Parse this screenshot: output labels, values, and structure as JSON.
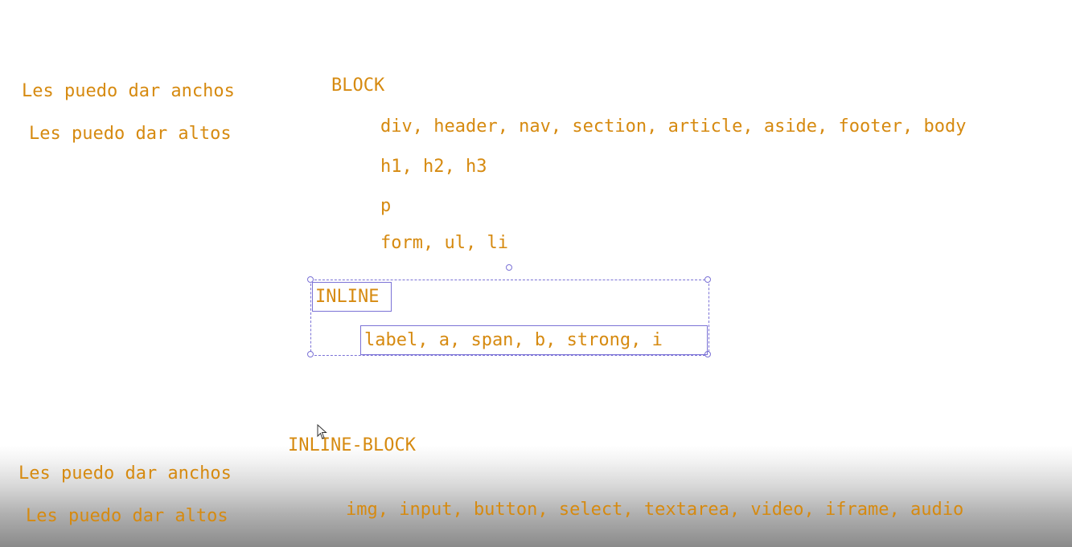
{
  "left_notes_top": {
    "line1": "Les puedo dar anchos",
    "line2": "Les puedo dar altos"
  },
  "block": {
    "heading": "BLOCK",
    "items": [
      "div, header, nav, section, article, aside, footer, body",
      "h1, h2, h3",
      "p",
      "form, ul, li"
    ]
  },
  "inline": {
    "heading": "INLINE",
    "items": "label, a, span, b, strong, i"
  },
  "inline_block": {
    "heading": "INLINE-BLOCK",
    "items": "img, input, button, select, textarea, video, iframe, audio"
  },
  "left_notes_bottom": {
    "line1": "Les puedo dar anchos",
    "line2": "Les puedo dar altos"
  },
  "colors": {
    "text": "#d68a10",
    "selection": "#7b72d6"
  },
  "icons": {
    "cursor": "mouse-pointer-icon"
  }
}
